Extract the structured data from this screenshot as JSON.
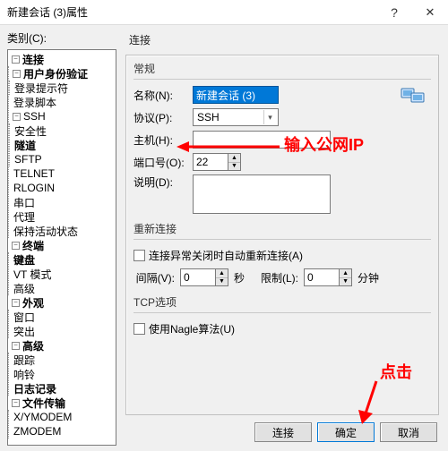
{
  "window": {
    "title": "新建会话 (3)属性",
    "help_glyph": "?",
    "close_glyph": "✕"
  },
  "left": {
    "category_label": "类别(C):",
    "tree": {
      "connection": "连接",
      "user_auth": "用户身份验证",
      "login_prompt": "登录提示符",
      "login_script": "登录脚本",
      "ssh": "SSH",
      "security": "安全性",
      "tunnel": "隧道",
      "sftp": "SFTP",
      "telnet": "TELNET",
      "rlogin": "RLOGIN",
      "serial": "串口",
      "proxy": "代理",
      "keepalive": "保持活动状态",
      "terminal": "终端",
      "keyboard": "键盘",
      "vtmode": "VT 模式",
      "advanced1": "高级",
      "appearance": "外观",
      "window": "窗口",
      "highlight": "突出",
      "advanced2": "高级",
      "trace": "跟踪",
      "bell": "响铃",
      "logging": "日志记录",
      "filetransfer": "文件传输",
      "xymodem": "X/YMODEM",
      "zmodem": "ZMODEM"
    }
  },
  "right": {
    "heading": "连接",
    "group_general": "常规",
    "labels": {
      "name": "名称(N):",
      "protocol": "协议(P):",
      "host": "主机(H):",
      "port": "端口号(O):",
      "description": "说明(D):"
    },
    "values": {
      "name": "新建会话 (3)",
      "protocol": "SSH",
      "host": "",
      "port": "22",
      "description": ""
    },
    "group_reconnect": "重新连接",
    "reconnect_checkbox": "连接异常关闭时自动重新连接(A)",
    "interval_label": "间隔(V):",
    "interval_value": "0",
    "seconds_label": "秒",
    "limit_label": "限制(L):",
    "limit_value": "0",
    "minutes_label": "分钟",
    "group_tcp": "TCP选项",
    "nagle_checkbox": "使用Nagle算法(U)"
  },
  "footer": {
    "connect": "连接",
    "ok": "确定",
    "cancel": "取消"
  },
  "annotations": {
    "host_hint": "输入公网IP",
    "click_hint": "点击"
  }
}
